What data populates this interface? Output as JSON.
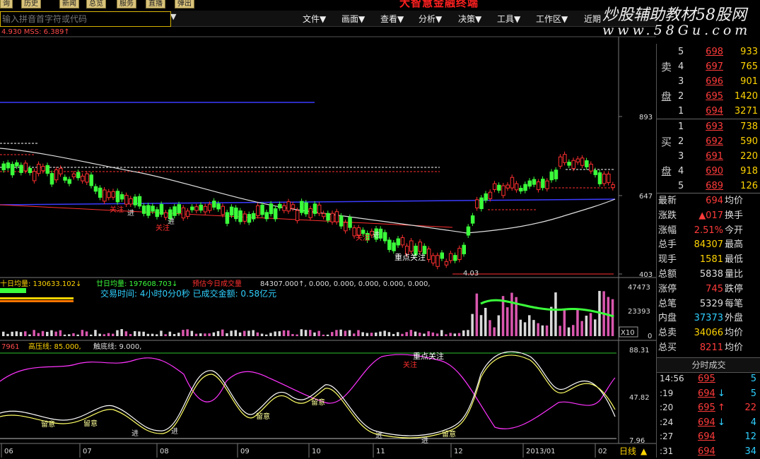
{
  "top_buttons": [
    "询",
    "历史",
    "新闻",
    "总览",
    "服务",
    "直播",
    "弹出"
  ],
  "app_title": "大智慧金融终端",
  "search": {
    "placeholder": "输入拼音首字符或代码"
  },
  "menu": [
    "文件▼",
    "画面▼",
    "查看▼",
    "分析▼",
    "决策▼",
    "工具▼",
    "工作区▼",
    "近期"
  ],
  "brand": {
    "line1": "炒股辅助教材58股网",
    "line2": "www.58Gu.com"
  },
  "chart": {
    "ma_label": "4.930  MSS: 6.389↑",
    "price_axis": [
      "893",
      "647",
      "403"
    ],
    "low_label": "4.03",
    "volume_legend": {
      "a": "十日均量: 130633.102↓",
      "b": "廿日均量: 197608.703↓",
      "c": "预估今日成交量",
      "d": "84307.000↑, 0.000, 0.000, 0.000, 0.000, 0.000,"
    },
    "trade_info": "交易时间: 4小时0分0秒   已成交金额: 0.58亿元",
    "volume_axis": [
      "47473",
      "23393",
      "0"
    ],
    "volume_unit": "X10",
    "osc_legend": {
      "a": "7961",
      "b": "高压线: 85.000,",
      "c": "触底线: 9.000,"
    },
    "osc_axis": [
      "88.31",
      "47.82",
      "7.96"
    ],
    "dates": [
      "06",
      "07",
      "08",
      "09",
      "10",
      "11",
      "12",
      "2013/01",
      "02"
    ],
    "period": "日线",
    "annotations": {
      "focus": "重点关注",
      "enter": "进",
      "attention": "留意",
      "focus_red": "关注"
    }
  },
  "orderbook": {
    "sell_label": [
      "卖",
      "盘"
    ],
    "buy_label": [
      "买",
      "盘"
    ],
    "sell": [
      {
        "lvl": "5",
        "price": "698",
        "vol": "933"
      },
      {
        "lvl": "4",
        "price": "697",
        "vol": "765"
      },
      {
        "lvl": "3",
        "price": "696",
        "vol": "901"
      },
      {
        "lvl": "2",
        "price": "695",
        "vol": "1420"
      },
      {
        "lvl": "1",
        "price": "694",
        "vol": "3271"
      }
    ],
    "buy": [
      {
        "lvl": "1",
        "price": "693",
        "vol": "738"
      },
      {
        "lvl": "2",
        "price": "692",
        "vol": "590"
      },
      {
        "lvl": "3",
        "price": "691",
        "vol": "220"
      },
      {
        "lvl": "4",
        "price": "690",
        "vol": "918"
      },
      {
        "lvl": "5",
        "price": "689",
        "vol": "126"
      }
    ]
  },
  "stats": [
    {
      "k": "最新",
      "v": "694",
      "c": "#ff3b3b",
      "k2": "均价"
    },
    {
      "k": "涨跌",
      "v": "▲017",
      "c": "#ff3b3b",
      "k2": "换手"
    },
    {
      "k": "涨幅",
      "v": "2.51%",
      "c": "#ff3b3b",
      "k2": "今开"
    },
    {
      "k": "总手",
      "v": "84307",
      "c": "#ffd400",
      "k2": "最高"
    },
    {
      "k": "现手",
      "v": "1581",
      "c": "#ffd400",
      "k2": "最低"
    },
    {
      "k": "总额",
      "v": "5838",
      "c": "#ddd",
      "k2": "量比"
    },
    {
      "k": "涨停",
      "v": "745",
      "c": "#ff3b3b",
      "k2": "跌停"
    },
    {
      "k": "总笔",
      "v": "5329",
      "c": "#ddd",
      "k2": "每笔"
    },
    {
      "k": "内盘",
      "v": "37373",
      "c": "#2fd0ff",
      "k2": "外盘"
    },
    {
      "k": "总卖",
      "v": "34066",
      "c": "#ffd400",
      "k2": "均价"
    },
    {
      "k": "总买",
      "v": "8211",
      "c": "#ff3b3b",
      "k2": "均价"
    }
  ],
  "ticks_tab": "分时成交",
  "ticks": [
    {
      "t": "14:56",
      "p": "695",
      "v": "5",
      "arrow": "",
      "vc": "#2fd0ff"
    },
    {
      "t": ":19",
      "p": "694",
      "v": "5",
      "arrow": "↓",
      "vc": "#2fd0ff"
    },
    {
      "t": ":20",
      "p": "695",
      "v": "22",
      "arrow": "↑",
      "vc": "#ff3b3b"
    },
    {
      "t": ":24",
      "p": "694",
      "v": "4",
      "arrow": "↓",
      "vc": "#2fd0ff"
    },
    {
      "t": ":27",
      "p": "694",
      "v": "12",
      "arrow": "",
      "vc": "#2fd0ff"
    },
    {
      "t": ":31",
      "p": "694",
      "v": "34",
      "arrow": "",
      "vc": "#2fd0ff"
    }
  ]
}
